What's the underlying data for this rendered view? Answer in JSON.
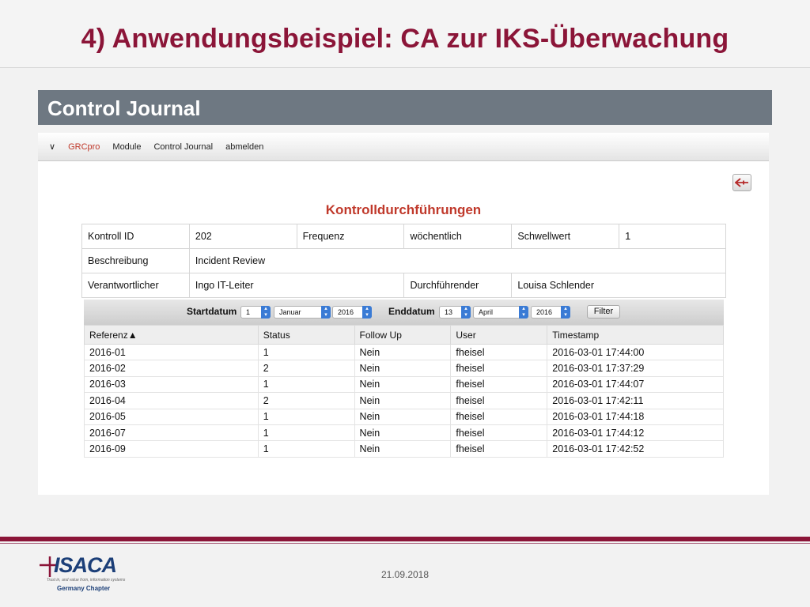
{
  "slide": {
    "title": "4) Anwendungsbeispiel: CA zur IKS-Überwachung",
    "section": "Control Journal",
    "footer_date": "21.09.2018",
    "logo_text": "ISACA",
    "logo_tagline": "Trust in, and value from, information systems",
    "logo_chapter": "Germany Chapter",
    "accent_color": "#8b1538"
  },
  "nav": {
    "caret": "∨",
    "brand": "GRCpro",
    "items": [
      "Module",
      "Control Journal",
      "abmelden"
    ]
  },
  "back_icon": "back-arrow-icon",
  "heading": "Kontrolldurchführungen",
  "info": {
    "row1": [
      "Kontroll ID",
      "202",
      "Frequenz",
      "wöchentlich",
      "Schwellwert",
      "1"
    ],
    "row2": [
      "Beschreibung",
      "Incident Review"
    ],
    "row3": [
      "Verantwortlicher",
      "Ingo IT-Leiter",
      "Durchführender",
      "Louisa Schlender"
    ]
  },
  "filter": {
    "start_label": "Startdatum",
    "start_day": "1",
    "start_month": "Januar",
    "start_year": "2016",
    "end_label": "Enddatum",
    "end_day": "13",
    "end_month": "April",
    "end_year": "2016",
    "button": "Filter"
  },
  "grid": {
    "columns": [
      "Referenz▲",
      "Status",
      "Follow Up",
      "User",
      "Timestamp"
    ],
    "rows": [
      [
        "2016-01",
        "1",
        "Nein",
        "fheisel",
        "2016-03-01 17:44:00"
      ],
      [
        "2016-02",
        "2",
        "Nein",
        "fheisel",
        "2016-03-01 17:37:29"
      ],
      [
        "2016-03",
        "1",
        "Nein",
        "fheisel",
        "2016-03-01 17:44:07"
      ],
      [
        "2016-04",
        "2",
        "Nein",
        "fheisel",
        "2016-03-01 17:42:11"
      ],
      [
        "2016-05",
        "1",
        "Nein",
        "fheisel",
        "2016-03-01 17:44:18"
      ],
      [
        "2016-07",
        "1",
        "Nein",
        "fheisel",
        "2016-03-01 17:44:12"
      ],
      [
        "2016-09",
        "1",
        "Nein",
        "fheisel",
        "2016-03-01 17:42:52"
      ]
    ]
  }
}
